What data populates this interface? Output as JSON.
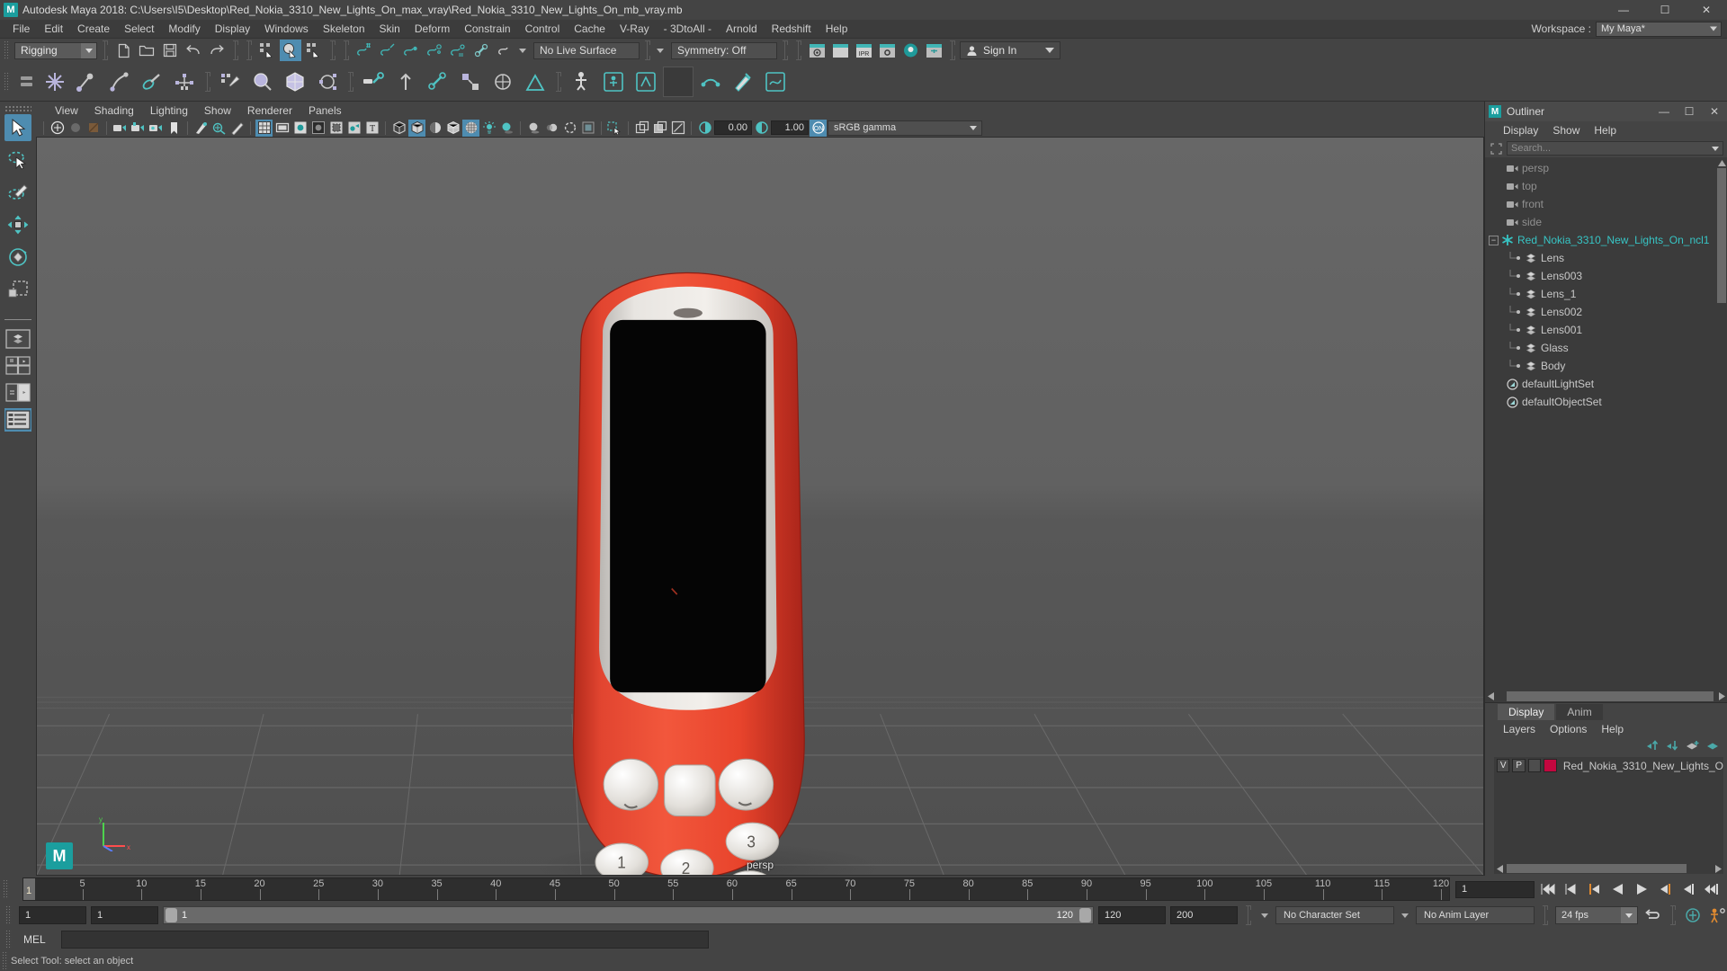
{
  "titlebar": {
    "app_icon": "maya-logo-icon",
    "title": "Autodesk Maya 2018: C:\\Users\\I5\\Desktop\\Red_Nokia_3310_New_Lights_On_max_vray\\Red_Nokia_3310_New_Lights_On_mb_vray.mb",
    "minimize": "—",
    "maximize": "☐",
    "close": "✕"
  },
  "menubar": {
    "items": [
      "File",
      "Edit",
      "Create",
      "Select",
      "Modify",
      "Display",
      "Windows",
      "Skeleton",
      "Skin",
      "Deform",
      "Constrain",
      "Control",
      "Cache",
      "V-Ray",
      "- 3DtoAll -",
      "Arnold",
      "Redshift",
      "Help"
    ],
    "workspace_label": "Workspace :",
    "workspace_value": "My Maya*"
  },
  "statusline": {
    "menu_set": "Rigging",
    "live_surface": "No Live Surface",
    "symmetry": "Symmetry: Off",
    "sign_in": "Sign In"
  },
  "viewport_menu": {
    "items": [
      "View",
      "Shading",
      "Lighting",
      "Show",
      "Renderer",
      "Panels"
    ]
  },
  "viewport_toolbar": {
    "exposure_value": "0.00",
    "gamma_value": "1.00",
    "color_profile": "sRGB gamma"
  },
  "viewport": {
    "camera_label": "persp",
    "axis_x": "x",
    "axis_y": "y",
    "axis_z": "z"
  },
  "outliner": {
    "title": "Outliner",
    "menu": [
      "Display",
      "Show",
      "Help"
    ],
    "search_placeholder": "Search...",
    "items": [
      {
        "label": "persp",
        "icon": "camera-icon",
        "indent": 1,
        "dim": true
      },
      {
        "label": "top",
        "icon": "camera-icon",
        "indent": 1,
        "dim": true
      },
      {
        "label": "front",
        "icon": "camera-icon",
        "indent": 1,
        "dim": true
      },
      {
        "label": "side",
        "icon": "camera-icon",
        "indent": 1,
        "dim": true
      },
      {
        "label": "Red_Nokia_3310_New_Lights_On_ncl1",
        "icon": "group-star-icon",
        "indent": 0,
        "dim": false,
        "expanded": true
      },
      {
        "label": "Lens",
        "icon": "mesh-icon",
        "indent": 2,
        "dim": false
      },
      {
        "label": "Lens003",
        "icon": "mesh-icon",
        "indent": 2,
        "dim": false
      },
      {
        "label": "Lens_1",
        "icon": "mesh-icon",
        "indent": 2,
        "dim": false
      },
      {
        "label": "Lens002",
        "icon": "mesh-icon",
        "indent": 2,
        "dim": false
      },
      {
        "label": "Lens001",
        "icon": "mesh-icon",
        "indent": 2,
        "dim": false
      },
      {
        "label": "Glass",
        "icon": "mesh-icon",
        "indent": 2,
        "dim": false
      },
      {
        "label": "Body",
        "icon": "mesh-icon",
        "indent": 2,
        "dim": false
      },
      {
        "label": "defaultLightSet",
        "icon": "set-icon",
        "indent": 1,
        "dim": false
      },
      {
        "label": "defaultObjectSet",
        "icon": "set-icon",
        "indent": 1,
        "dim": false
      }
    ]
  },
  "layers_panel": {
    "tabs": [
      {
        "label": "Display",
        "active": true
      },
      {
        "label": "Anim",
        "active": false
      }
    ],
    "menu": [
      "Layers",
      "Options",
      "Help"
    ],
    "rows": [
      {
        "visibility": "V",
        "playback": "P",
        "shading": "",
        "color": "#c3073f",
        "name": "Red_Nokia_3310_New_Lights_O"
      }
    ],
    "column_headers": {
      "v": "V",
      "p": "P"
    }
  },
  "timeline": {
    "ticks": [
      5,
      10,
      15,
      20,
      25,
      30,
      35,
      40,
      45,
      50,
      55,
      60,
      65,
      70,
      75,
      80,
      85,
      90,
      95,
      100,
      105,
      110,
      115,
      120
    ],
    "current_frame": "1",
    "current_frame_field": "1",
    "start": 1,
    "end": 120
  },
  "range_slider": {
    "anim_start": "1",
    "range_start": "1",
    "range_bar_start": "1",
    "range_bar_end": "120",
    "range_end": "120",
    "anim_end": "200",
    "character_set": "No Character Set",
    "anim_layer": "No Anim Layer",
    "fps": "24 fps"
  },
  "command_line": {
    "language": "MEL",
    "input_value": "",
    "output_value": ""
  },
  "help_line": {
    "text": "Select Tool: select an object"
  },
  "colors": {
    "accent_blue": "#4e8cb0",
    "accent_cyan": "#37c4c4",
    "panel_bg": "#444444",
    "viewport_bg": "#5c5c5c",
    "layer_color": "#c3073f",
    "phone_red": "#e8402e",
    "phone_light": "#e8e4e0"
  }
}
